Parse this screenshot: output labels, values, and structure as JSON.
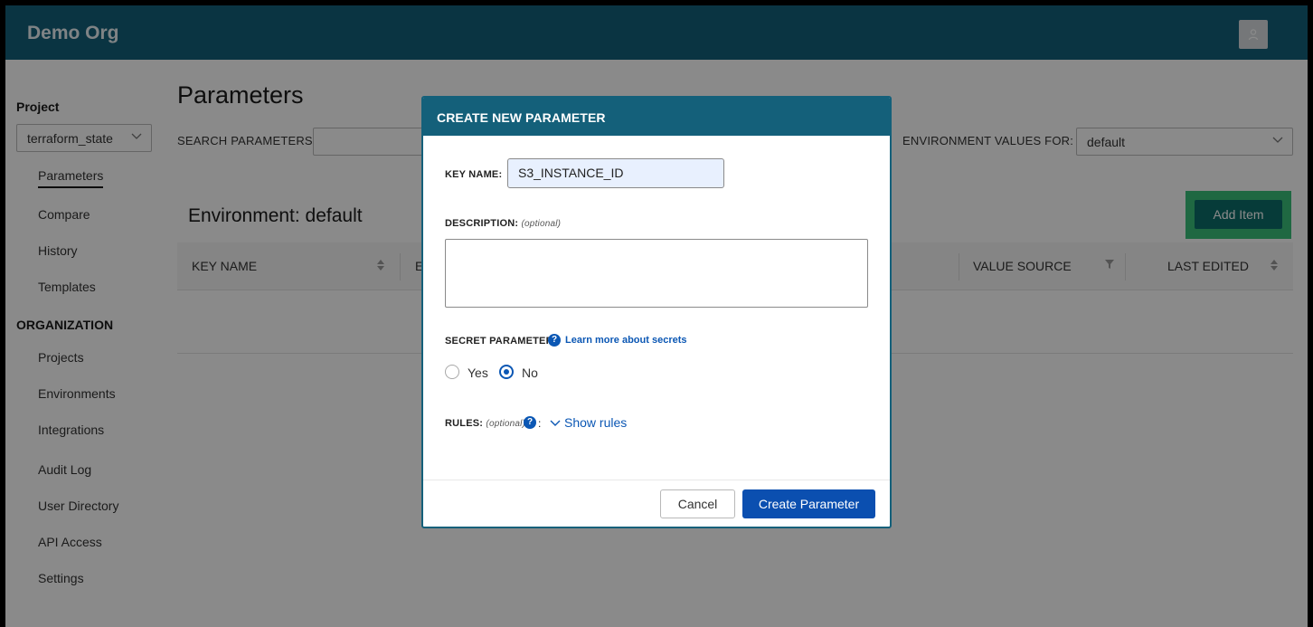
{
  "header": {
    "org_name": "Demo Org",
    "user_icon": "user-icon"
  },
  "sidebar": {
    "project_heading": "Project",
    "project_select": "terraform_state",
    "project_items": [
      "Parameters",
      "Compare",
      "History",
      "Templates"
    ],
    "organization_heading": "ORGANIZATION",
    "organization_items": [
      "Projects",
      "Environments",
      "Integrations",
      "Audit Log",
      "User Directory",
      "API Access",
      "Settings"
    ]
  },
  "main": {
    "title": "Parameters",
    "search_label": "SEARCH PARAMETERS :",
    "search_value": "",
    "env_values_label": "ENVIRONMENT VALUES FOR:",
    "env_values_select": "default",
    "environment_title": "Environment: default",
    "add_item_label": "Add Item",
    "columns": [
      "KEY NAME",
      "E",
      "VALUE SOURCE",
      "LAST EDITED"
    ]
  },
  "modal": {
    "title": "CREATE NEW PARAMETER",
    "key_name_label": "KEY NAME:",
    "key_name_value": "S3_INSTANCE_ID",
    "description_label": "DESCRIPTION:",
    "optional_text": "(optional)",
    "description_value": "",
    "secret_label": "SECRET PARAMETER:",
    "learn_more": "Learn more about secrets",
    "secret_options": [
      {
        "label": "Yes",
        "checked": false
      },
      {
        "label": "No",
        "checked": true
      }
    ],
    "rules_label": "RULES:",
    "rules_optional": "(optional)",
    "show_rules": "Show rules",
    "cancel_label": "Cancel",
    "create_label": "Create Parameter"
  },
  "colors": {
    "header_bg": "#14607a",
    "primary_button": "#0b4fb0",
    "add_item_button": "#0c6e6a",
    "link": "#0b57b4"
  }
}
